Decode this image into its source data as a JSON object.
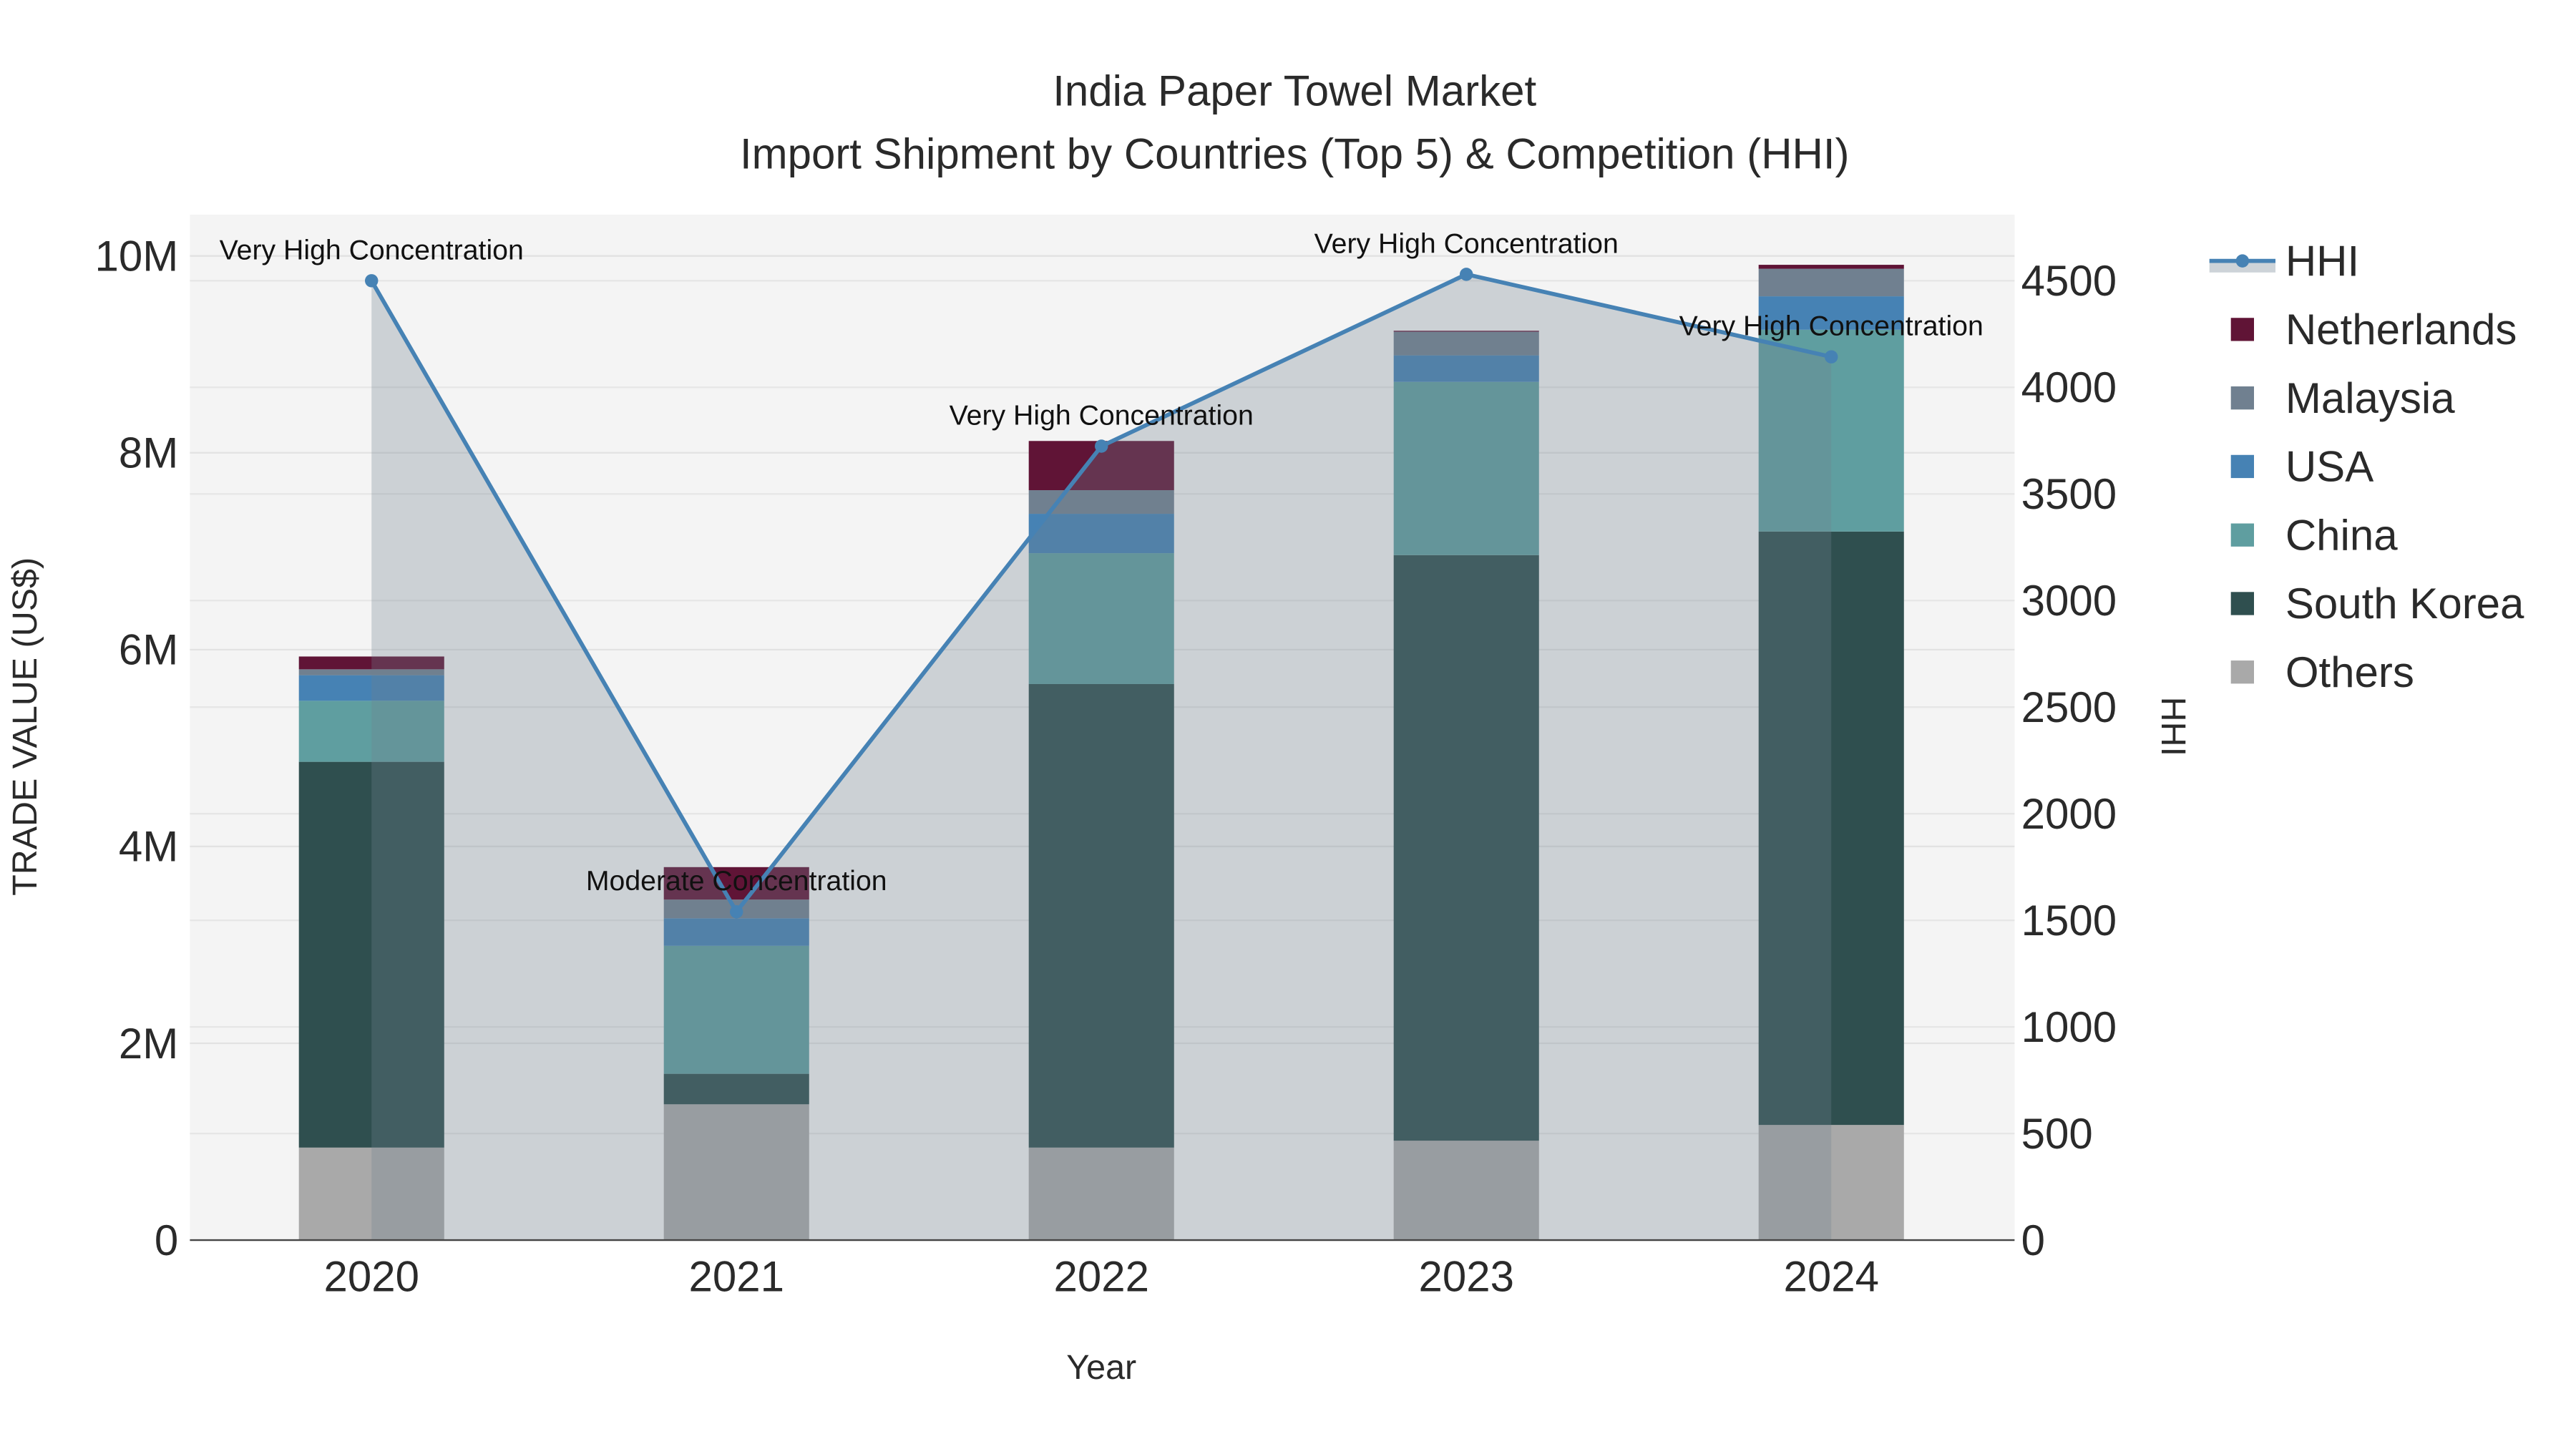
{
  "chart_data": {
    "type": "bar",
    "title": "India Paper Towel Market",
    "subtitle": "Import Shipment by Countries (Top 5) & Competition (HHI)",
    "xlabel": "Year",
    "ylabel": "TRADE VALUE (US$)",
    "y2label": "HHI",
    "categories": [
      "2020",
      "2021",
      "2022",
      "2023",
      "2024"
    ],
    "ylim": [
      0,
      10400000
    ],
    "y2lim": [
      0,
      4800
    ],
    "yticks": [
      {
        "v": 0,
        "label": "0"
      },
      {
        "v": 2000000,
        "label": "2M"
      },
      {
        "v": 4000000,
        "label": "4M"
      },
      {
        "v": 6000000,
        "label": "6M"
      },
      {
        "v": 8000000,
        "label": "8M"
      },
      {
        "v": 10000000,
        "label": "10M"
      }
    ],
    "y2ticks": [
      "0",
      "500",
      "1000",
      "1500",
      "2000",
      "2500",
      "3000",
      "3500",
      "4000",
      "4500"
    ],
    "stacked": true,
    "series": [
      {
        "name": "Others",
        "color": "#A9A9A9",
        "values": [
          940000,
          1380000,
          940000,
          1010000,
          1170000
        ]
      },
      {
        "name": "South Korea",
        "color": "#2F4F4F",
        "values": [
          3920000,
          310000,
          4710000,
          5950000,
          6030000
        ]
      },
      {
        "name": "China",
        "color": "#5F9EA0",
        "values": [
          620000,
          1300000,
          1330000,
          1760000,
          2050000
        ]
      },
      {
        "name": "USA",
        "color": "#4682B4",
        "values": [
          260000,
          280000,
          400000,
          270000,
          340000
        ]
      },
      {
        "name": "Malaysia",
        "color": "#708090",
        "values": [
          60000,
          190000,
          240000,
          240000,
          280000
        ]
      },
      {
        "name": "Netherlands",
        "color": "#601436",
        "values": [
          130000,
          330000,
          500000,
          10000,
          40000
        ]
      }
    ],
    "line": {
      "name": "HHI",
      "color": "#4682B4",
      "axis": "y2",
      "values": [
        4500,
        1540,
        3724,
        4530,
        4143
      ],
      "annotations": [
        "Very High Concentration",
        "Moderate Concentration",
        "Very High Concentration",
        "Very High Concentration",
        "Very High Concentration"
      ]
    },
    "legend_order": [
      "HHI",
      "Netherlands",
      "Malaysia",
      "USA",
      "China",
      "South Korea",
      "Others"
    ],
    "legend_position": "right",
    "grid": true
  }
}
